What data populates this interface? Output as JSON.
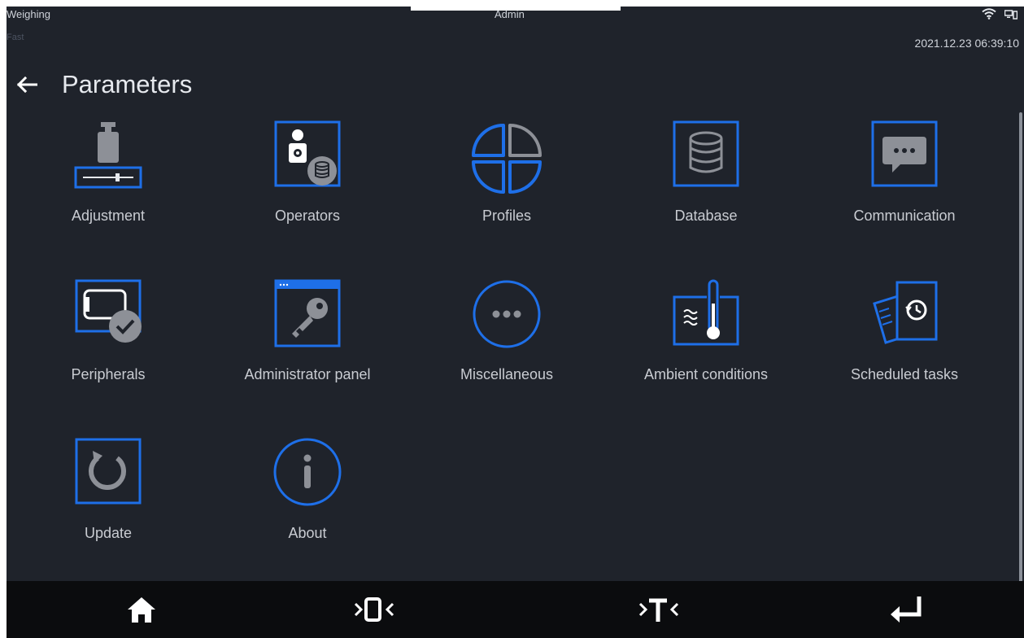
{
  "status": {
    "mode": "Weighing",
    "sub_mode": "Fast",
    "user": "Admin",
    "datetime": "2021.12.23 06:39:10",
    "icons": [
      "wifi-icon",
      "computer-link-icon"
    ]
  },
  "header": {
    "back_icon": "back-arrow-icon",
    "title": "Parameters"
  },
  "tiles": [
    {
      "label": "Adjustment",
      "icon": "adjustment-icon"
    },
    {
      "label": "Operators",
      "icon": "operators-icon"
    },
    {
      "label": "Profiles",
      "icon": "profiles-icon"
    },
    {
      "label": "Database",
      "icon": "database-icon"
    },
    {
      "label": "Communication",
      "icon": "communication-icon"
    },
    {
      "label": "Peripherals",
      "icon": "peripherals-icon"
    },
    {
      "label": "Administrator panel",
      "icon": "administrator-panel-icon"
    },
    {
      "label": "Miscellaneous",
      "icon": "miscellaneous-icon"
    },
    {
      "label": "Ambient conditions",
      "icon": "ambient-conditions-icon"
    },
    {
      "label": "Scheduled tasks",
      "icon": "scheduled-tasks-icon"
    },
    {
      "label": "Update",
      "icon": "update-icon"
    },
    {
      "label": "About",
      "icon": "about-icon"
    }
  ],
  "bottom_bar": {
    "buttons": [
      "home-icon",
      "zero-icon",
      "tare-icon",
      "enter-icon"
    ]
  },
  "colors": {
    "background": "#1f232b",
    "accent_blue": "#1e6fe8",
    "icon_gray": "#8d9097",
    "bottom_bar": "#0b0c0e"
  }
}
